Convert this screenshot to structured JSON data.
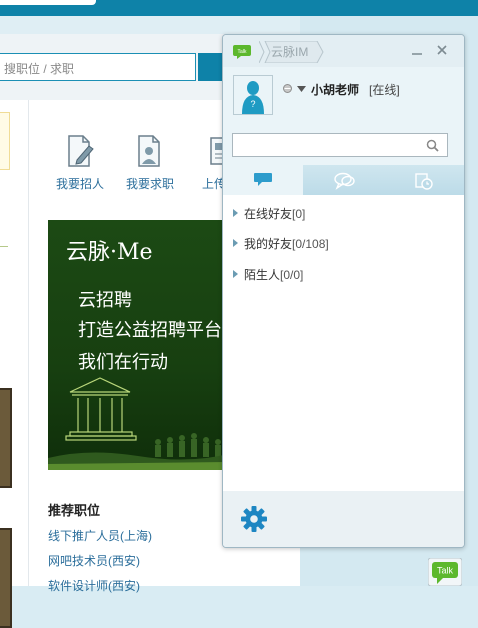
{
  "background_page": {
    "search_placeholder": "搜职位 / 求职",
    "quick_links": [
      {
        "label": "我要招人",
        "icon": "edit-document-icon"
      },
      {
        "label": "我要求职",
        "icon": "user-document-icon"
      },
      {
        "label": "上传简",
        "icon": "resume-upload-icon"
      }
    ],
    "banner": {
      "title": "云脉·Me",
      "lines": [
        "云招聘",
        "打造公益招聘平台",
        "我们在行动"
      ]
    },
    "recommended": {
      "title": "推荐职位",
      "items": [
        "线下推广人员(上海)",
        "网吧技术员(西安)",
        "软件设计师(西安)"
      ]
    }
  },
  "im": {
    "logo_text": "Talk",
    "breadcrumb": "云脉IM",
    "user": {
      "name": "小胡老师",
      "status": "[在线]"
    },
    "search": {
      "placeholder": "",
      "value": ""
    },
    "tabs": [
      {
        "name": "conversations",
        "icon": "chat-bubble-icon",
        "active": true
      },
      {
        "name": "groups",
        "icon": "group-chat-icon",
        "active": false
      },
      {
        "name": "recent",
        "icon": "recent-history-icon",
        "active": false
      }
    ],
    "groups": [
      {
        "label": "在线好友",
        "count": "[0]"
      },
      {
        "label": "我的好友",
        "count": "[0/108]"
      },
      {
        "label": "陌生人",
        "count": "[0/0]"
      }
    ],
    "talk_button": "Talk"
  },
  "colors": {
    "brand_blue": "#0e82a8",
    "settings_icon": "#1d86c2",
    "talk_green": "#5cb82d"
  }
}
